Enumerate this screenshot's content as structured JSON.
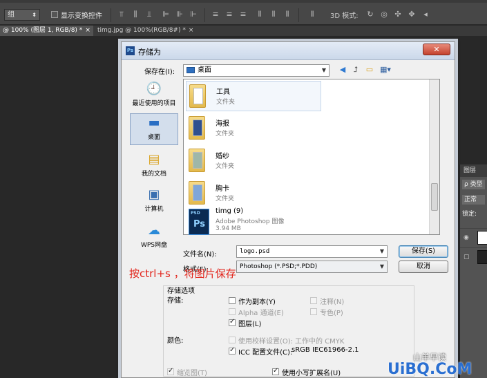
{
  "options_bar": {
    "group_select": "组",
    "show_transform_label": "显示变换控件",
    "mode_3d_label": "3D 模式:"
  },
  "doc_tabs": [
    {
      "label": "@ 100% (图层 1, RGB/8) *"
    },
    {
      "label": "timg.jpg @ 100%(RGB/8#) *"
    }
  ],
  "layers_panel": {
    "header": "图层",
    "search": "ρ 类型",
    "blend_mode": "正常",
    "lock_label": "锁定:"
  },
  "dialog": {
    "title": "存储为",
    "save_in_label": "保存在(I):",
    "save_in_value": "桌面",
    "places": [
      {
        "label": "最近使用的项目",
        "icon": "recent-icon"
      },
      {
        "label": "桌面",
        "icon": "desktop-icon"
      },
      {
        "label": "我的文档",
        "icon": "documents-icon"
      },
      {
        "label": "计算机",
        "icon": "computer-icon"
      },
      {
        "label": "WPS网盘",
        "icon": "cloud-icon"
      }
    ],
    "files": [
      {
        "name": "工具",
        "type": "文件夹"
      },
      {
        "name": "海报",
        "type": "文件夹"
      },
      {
        "name": "婚纱",
        "type": "文件夹"
      },
      {
        "name": "胸卡",
        "type": "文件夹"
      },
      {
        "name": "timg (9)",
        "type": "Adobe Photoshop 图像",
        "size": "3.94 MB"
      }
    ],
    "filename_label": "文件名(N):",
    "filename_value": "logo.psd",
    "format_label": "格式(F):",
    "format_value": "Photoshop (*.PSD;*.PDD)",
    "save_button": "保存(S)",
    "cancel_button": "取消",
    "save_options_title": "存储选项",
    "storage_label": "存储:",
    "as_copy": "作为副本(Y)",
    "notes": "注释(N)",
    "alpha": "Alpha 通道(E)",
    "spot": "专色(P)",
    "layers": "图层(L)",
    "color_label": "颜色:",
    "use_proof": "使用校样设置(O):",
    "proof_value": "工作中的 CMYK",
    "icc": "ICC 配置文件(C):",
    "icc_value": "sRGB IEC61966-2.1",
    "thumbnail": "缩览图(T)",
    "lowercase_ext": "使用小写扩展名(U)"
  },
  "annotation": "按ctrl+s ，将图片保存",
  "watermark": {
    "line1": "山羊早读",
    "line2": "UiBQ.CoM"
  }
}
